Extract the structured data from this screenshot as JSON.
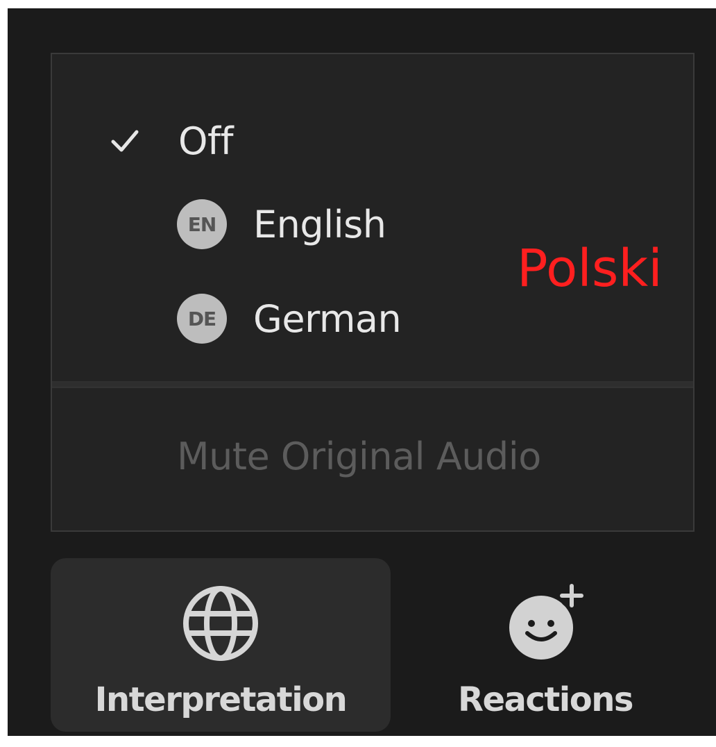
{
  "menu": {
    "items": [
      {
        "label": "Off",
        "checked": true
      },
      {
        "label": "English",
        "badge": "EN"
      },
      {
        "label": "German",
        "badge": "DE"
      }
    ],
    "mute_label": "Mute Original Audio"
  },
  "overlay": {
    "text": "Polski",
    "color": "#ff1f1f"
  },
  "toolbar": {
    "interpretation_label": "Interpretation",
    "reactions_label": "Reactions"
  },
  "icons": {
    "check": "checkmark-icon",
    "interpretation": "globe-icon",
    "reactions": "smiley-plus-icon"
  }
}
